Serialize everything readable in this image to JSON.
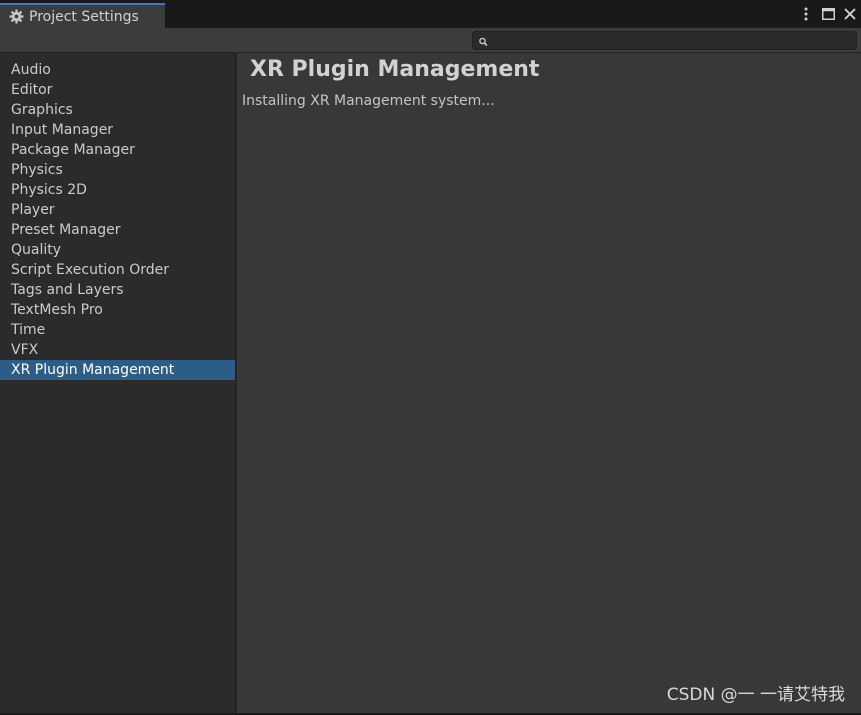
{
  "window": {
    "tab_title": "Project Settings",
    "tab_icon": "gear-icon"
  },
  "search": {
    "value": "",
    "placeholder": ""
  },
  "sidebar": {
    "items": [
      {
        "label": "Audio"
      },
      {
        "label": "Editor"
      },
      {
        "label": "Graphics"
      },
      {
        "label": "Input Manager"
      },
      {
        "label": "Package Manager"
      },
      {
        "label": "Physics"
      },
      {
        "label": "Physics 2D"
      },
      {
        "label": "Player"
      },
      {
        "label": "Preset Manager"
      },
      {
        "label": "Quality"
      },
      {
        "label": "Script Execution Order"
      },
      {
        "label": "Tags and Layers"
      },
      {
        "label": "TextMesh Pro"
      },
      {
        "label": "Time"
      },
      {
        "label": "VFX"
      },
      {
        "label": "XR Plugin Management",
        "selected": true
      }
    ]
  },
  "main": {
    "title": "XR Plugin Management",
    "status": "Installing XR Management system..."
  },
  "watermark": "CSDN @一 一请艾特我",
  "colors": {
    "selected_bg": "#2c5d87",
    "tab_accent": "#3a79bb",
    "panel_bg": "#383838",
    "sidebar_bg": "#2b2b2b"
  }
}
